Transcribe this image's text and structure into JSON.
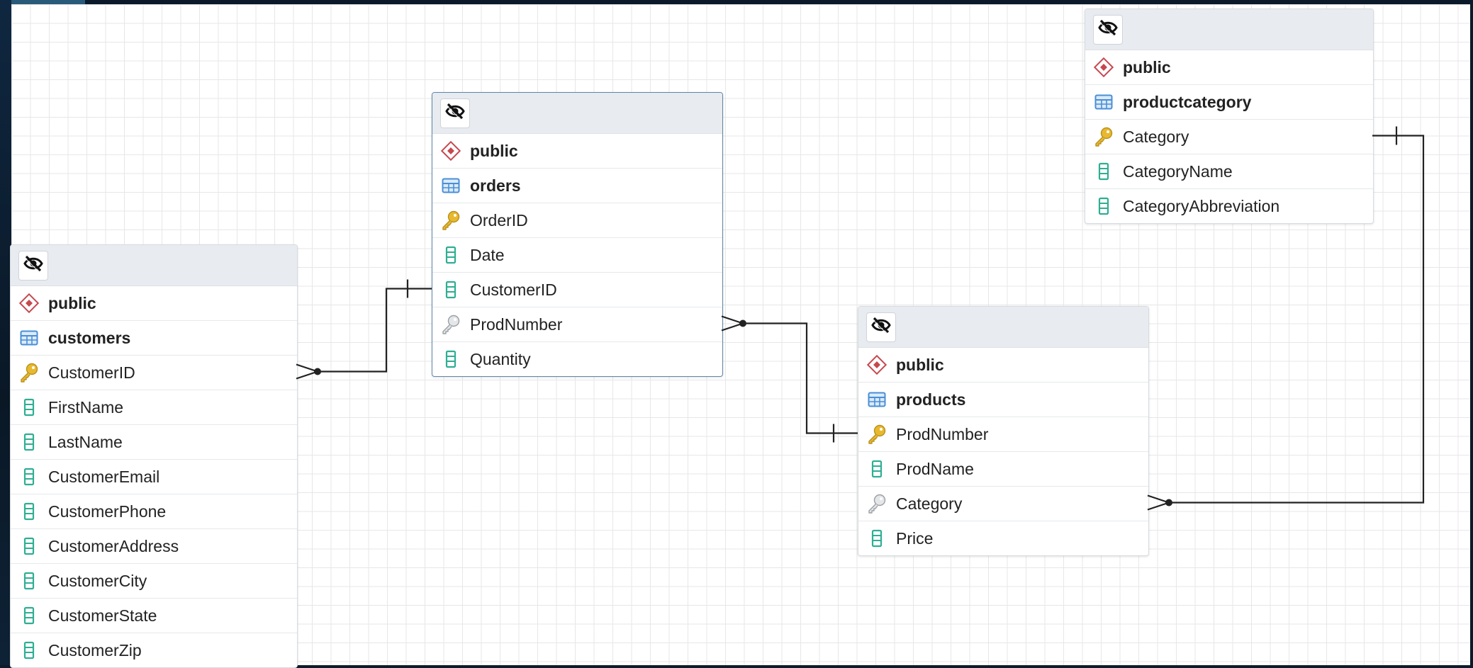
{
  "entities": [
    {
      "id": "customers",
      "schema": "public",
      "table": "customers",
      "columns": [
        {
          "name": "CustomerID",
          "key": "primary"
        },
        {
          "name": "FirstName",
          "key": "none"
        },
        {
          "name": "LastName",
          "key": "none"
        },
        {
          "name": "CustomerEmail",
          "key": "none"
        },
        {
          "name": "CustomerPhone",
          "key": "none"
        },
        {
          "name": "CustomerAddress",
          "key": "none"
        },
        {
          "name": "CustomerCity",
          "key": "none"
        },
        {
          "name": "CustomerState",
          "key": "none"
        },
        {
          "name": "CustomerZip",
          "key": "none"
        }
      ]
    },
    {
      "id": "orders",
      "schema": "public",
      "table": "orders",
      "selected": true,
      "columns": [
        {
          "name": "OrderID",
          "key": "primary"
        },
        {
          "name": "Date",
          "key": "none"
        },
        {
          "name": "CustomerID",
          "key": "none"
        },
        {
          "name": "ProdNumber",
          "key": "foreign"
        },
        {
          "name": "Quantity",
          "key": "none"
        }
      ]
    },
    {
      "id": "products",
      "schema": "public",
      "table": "products",
      "columns": [
        {
          "name": "ProdNumber",
          "key": "primary"
        },
        {
          "name": "ProdName",
          "key": "none"
        },
        {
          "name": "Category",
          "key": "foreign"
        },
        {
          "name": "Price",
          "key": "none"
        }
      ]
    },
    {
      "id": "productcategory",
      "schema": "public",
      "table": "productcategory",
      "columns": [
        {
          "name": "Category",
          "key": "primary"
        },
        {
          "name": "CategoryName",
          "key": "none"
        },
        {
          "name": "CategoryAbbreviation",
          "key": "none"
        }
      ]
    }
  ],
  "relationships": [
    {
      "from": "orders",
      "from_column": "CustomerID",
      "to": "customers",
      "to_column": "CustomerID",
      "type": "one-to-many"
    },
    {
      "from": "products",
      "from_column": "ProdNumber",
      "to": "orders",
      "to_column": "ProdNumber",
      "type": "one-to-many"
    },
    {
      "from": "productcategory",
      "from_column": "Category",
      "to": "products",
      "to_column": "Category",
      "type": "one-to-many"
    }
  ],
  "icons": {
    "header_toggle": "eye-slash-icon",
    "schema": "schema-diamond-icon",
    "table": "table-grid-icon",
    "primary": "primary-key-icon",
    "foreign": "foreign-key-icon",
    "none": "column-icon"
  },
  "colors": {
    "primary_key": "#e8b92f",
    "foreign_key": "#9aa0a6",
    "column": "#2fae93",
    "schema": "#c7474f",
    "table": "#4a8fd4",
    "link": "#222222",
    "selected_border": "#5f86ad"
  }
}
